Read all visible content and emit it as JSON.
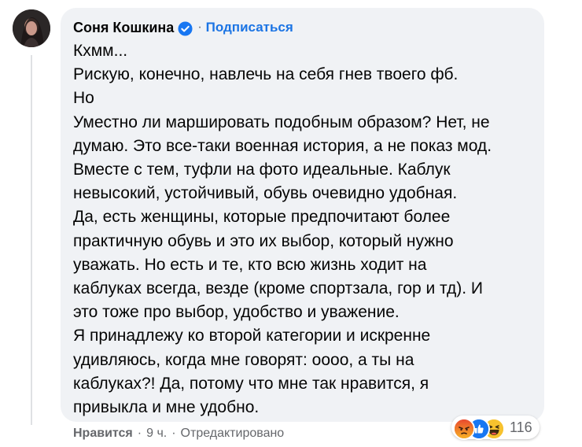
{
  "comment": {
    "author": "Соня Кошкина",
    "follow_label": "Подписаться",
    "separator": "·",
    "lines": [
      "Кхмм...",
      "Рискую, конечно, навлечь на себя гнев твоего фб.",
      "Но",
      "Уместно ли маршировать подобным образом? Нет, не",
      "думаю. Это все-таки военная история, а не показ мод.",
      "Вместе с тем, туфли на фото идеальные. Каблук",
      "невысокий, устойчивый, обувь очевидно удобная.",
      "Да, есть женщины, которые предпочитают более",
      "практичную обувь и это их выбор, который нужно",
      "уважать. Но есть и те, кто всю жизнь ходит на",
      "каблуках всегда, везде (кроме спортзала, гор и тд). И",
      "это тоже про выбор, удобство и уважение.",
      "Я принадлежу ко второй категории и искренне",
      "удивляюсь, когда мне говорят: оооо, а ты на",
      "каблуках?! Да, потому что мне так нравится, я",
      "привыкла и мне удобно."
    ],
    "reactions": {
      "count": "116",
      "icons": [
        "angry-reaction",
        "like-reaction",
        "haha-reaction"
      ]
    },
    "footer": {
      "like_label": "Нравится",
      "time": "9 ч.",
      "edited": "Отредактировано"
    }
  },
  "colors": {
    "bubble": "#f0f2f5",
    "link": "#1b74e4",
    "meta": "#65676b",
    "verified": "#1877f2"
  }
}
